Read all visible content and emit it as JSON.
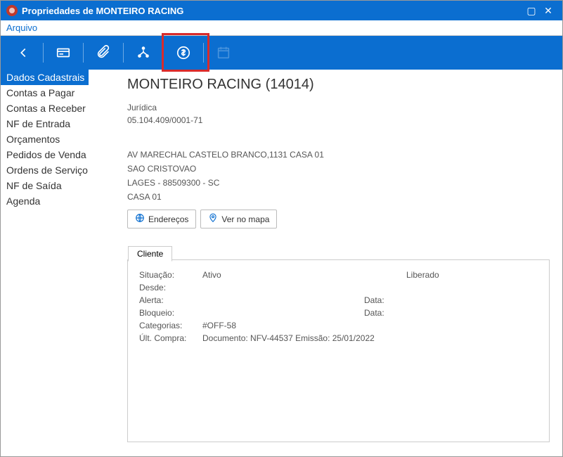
{
  "window": {
    "title": "Propriedades de MONTEIRO RACING"
  },
  "menubar": {
    "arquivo": "Arquivo"
  },
  "sidebar": {
    "items": [
      "Dados Cadastrais",
      "Contas a Pagar",
      "Contas a Receber",
      "NF de Entrada",
      "Orçamentos",
      "Pedidos de Venda",
      "Ordens de Serviço",
      "NF de Saída",
      "Agenda"
    ]
  },
  "entity": {
    "heading": "MONTEIRO RACING (14014)",
    "type": "Jurídica",
    "cnpj": "05.104.409/0001-71",
    "address_line1": "AV MARECHAL CASTELO BRANCO,1131 CASA 01",
    "address_line2": "SAO CRISTOVAO",
    "address_line3": "LAGES - 88509300 - SC",
    "address_line4": "CASA 01"
  },
  "buttons": {
    "enderecos": "Endereços",
    "ver_mapa": "Ver no mapa"
  },
  "client_tab": {
    "label": "Cliente",
    "situacao_lbl": "Situação:",
    "situacao_val": "Ativo",
    "liberado": "Liberado",
    "desde_lbl": "Desde:",
    "alerta_lbl": "Alerta:",
    "data1_lbl": "Data:",
    "bloqueio_lbl": "Bloqueio:",
    "data2_lbl": "Data:",
    "categorias_lbl": "Categorias:",
    "categorias_val": "#OFF-58",
    "ultcompra_lbl": "Últ. Compra:",
    "ultcompra_val": "Documento: NFV-44537   Emissão: 25/01/2022"
  }
}
